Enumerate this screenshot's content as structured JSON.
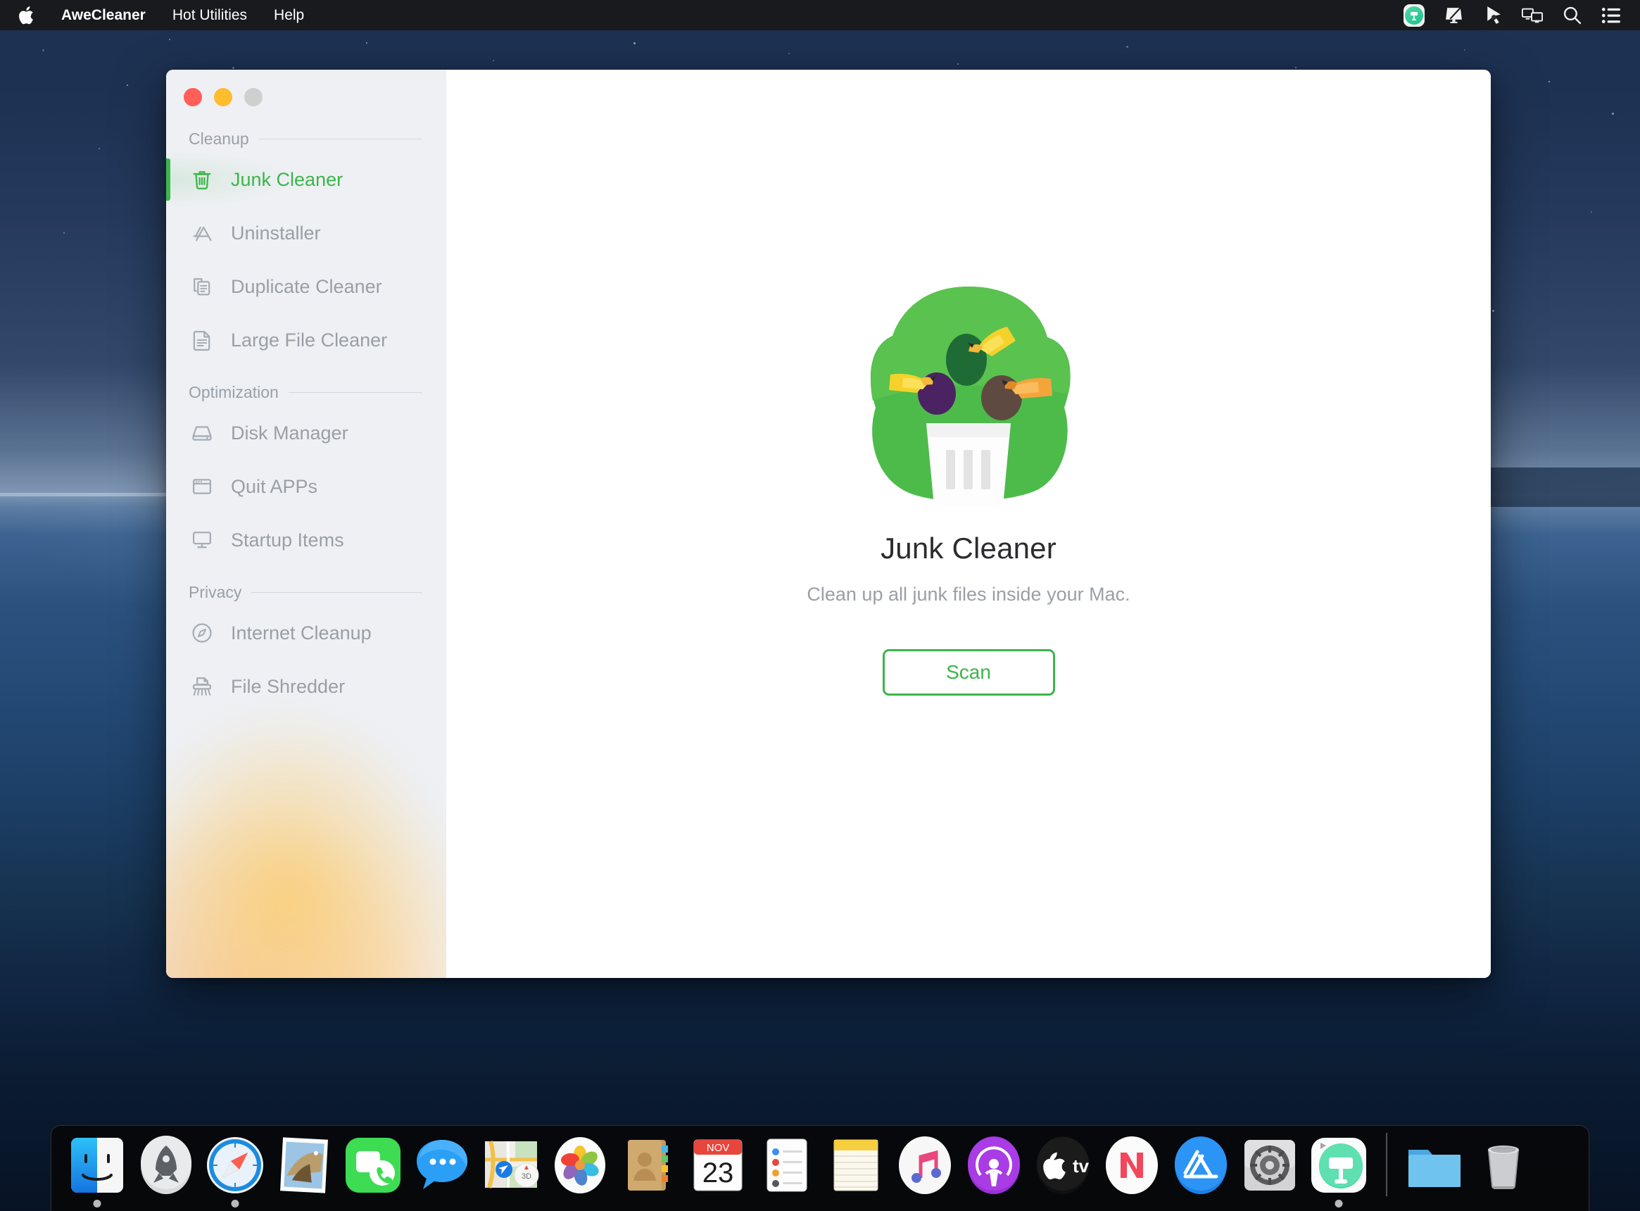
{
  "menubar": {
    "apple_icon": "apple-logo",
    "items": [
      {
        "label": "AweCleaner",
        "bold": true
      },
      {
        "label": "Hot Utilities",
        "bold": false
      },
      {
        "label": "Help",
        "bold": false
      }
    ],
    "status_icons": [
      {
        "name": "awecleaner-menubar-icon"
      },
      {
        "name": "display-brightness-icon"
      },
      {
        "name": "cursor-pointer-icon"
      },
      {
        "name": "screen-mirroring-icon"
      },
      {
        "name": "search-icon"
      },
      {
        "name": "control-center-icon"
      }
    ]
  },
  "window": {
    "traffic_lights": [
      {
        "name": "close",
        "color": "#ff5f57"
      },
      {
        "name": "minimize",
        "color": "#febc2e"
      },
      {
        "name": "zoom",
        "color": "#cfcfcf"
      }
    ],
    "accent_color": "#3cb54a"
  },
  "sidebar": {
    "sections": [
      {
        "title": "Cleanup",
        "items": [
          {
            "label": "Junk Cleaner",
            "icon": "trash-icon",
            "active": true
          },
          {
            "label": "Uninstaller",
            "icon": "app-store-icon",
            "active": false
          },
          {
            "label": "Duplicate Cleaner",
            "icon": "duplicate-documents-icon",
            "active": false
          },
          {
            "label": "Large File Cleaner",
            "icon": "document-icon",
            "active": false
          }
        ]
      },
      {
        "title": "Optimization",
        "items": [
          {
            "label": "Disk Manager",
            "icon": "hard-drive-icon",
            "active": false
          },
          {
            "label": "Quit APPs",
            "icon": "window-icon",
            "active": false
          },
          {
            "label": "Startup Items",
            "icon": "monitor-icon",
            "active": false
          }
        ]
      },
      {
        "title": "Privacy",
        "items": [
          {
            "label": "Internet Cleanup",
            "icon": "compass-icon",
            "active": false
          },
          {
            "label": "File Shredder",
            "icon": "shredder-icon",
            "active": false
          }
        ]
      }
    ]
  },
  "main": {
    "illustration": "junk-cleaner-illustration",
    "title": "Junk Cleaner",
    "subtitle": "Clean up all junk files inside your Mac.",
    "scan_button": "Scan"
  },
  "dock": {
    "items": [
      {
        "name": "finder",
        "running": true
      },
      {
        "name": "launchpad",
        "running": false
      },
      {
        "name": "safari",
        "running": true
      },
      {
        "name": "mail",
        "running": false
      },
      {
        "name": "facetime",
        "running": false
      },
      {
        "name": "messages",
        "running": false
      },
      {
        "name": "maps",
        "running": false
      },
      {
        "name": "photos",
        "running": false
      },
      {
        "name": "contacts",
        "running": false
      },
      {
        "name": "calendar",
        "running": false
      },
      {
        "name": "reminders",
        "running": false
      },
      {
        "name": "notes",
        "running": false
      },
      {
        "name": "itunes",
        "running": false
      },
      {
        "name": "podcasts",
        "running": false
      },
      {
        "name": "apple-tv",
        "running": false
      },
      {
        "name": "news",
        "running": false
      },
      {
        "name": "app-store",
        "running": false
      },
      {
        "name": "system-preferences",
        "running": false
      },
      {
        "name": "awecleaner",
        "running": true
      },
      {
        "name": "downloads-folder",
        "running": false
      },
      {
        "name": "trash",
        "running": false
      }
    ],
    "calendar_month": "NOV",
    "calendar_day": "23"
  }
}
